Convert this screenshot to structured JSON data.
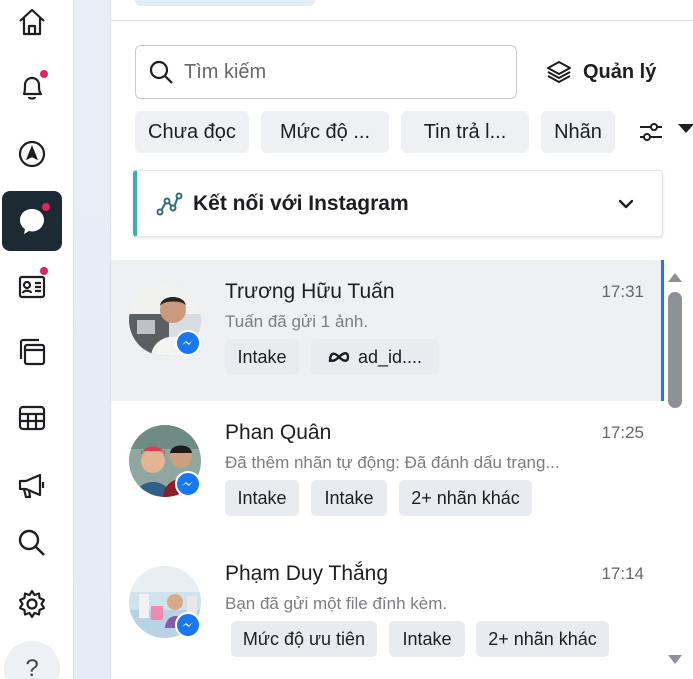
{
  "rail": {
    "items": [
      {
        "icon": "home-icon"
      },
      {
        "icon": "bell-icon",
        "notification": true
      },
      {
        "icon": "compass-icon"
      },
      {
        "icon": "chat-bubble-icon",
        "active": true,
        "notification": true
      },
      {
        "icon": "contact-card-icon",
        "notification": true
      },
      {
        "icon": "pages-icon"
      },
      {
        "icon": "table-icon"
      },
      {
        "icon": "megaphone-icon"
      },
      {
        "icon": "search-icon"
      },
      {
        "icon": "gear-icon"
      }
    ],
    "help_label": "?"
  },
  "search": {
    "placeholder": "Tìm kiếm",
    "value": ""
  },
  "manage": {
    "label": "Quản lý"
  },
  "filters": [
    {
      "label": "Chưa đọc"
    },
    {
      "label": "Mức độ ..."
    },
    {
      "label": "Tin trả l..."
    },
    {
      "label": "Nhãn"
    }
  ],
  "instagram": {
    "label": "Kết nối với Instagram"
  },
  "conversations": [
    {
      "name": "Trương Hữu Tuấn",
      "time": "17:31",
      "preview": "Tuấn đã gửi 1 ảnh.",
      "selected": true,
      "tags": [
        {
          "label": "Intake"
        },
        {
          "label": "ad_id....",
          "icon": "meta-icon"
        }
      ]
    },
    {
      "name": "Phan Quân",
      "time": "17:25",
      "preview": "Đã thêm nhãn tự động: Đã đánh dấu trạng...",
      "selected": false,
      "tags": [
        {
          "label": "Intake"
        },
        {
          "label": "Intake"
        },
        {
          "label": "2+ nhãn khác"
        }
      ]
    },
    {
      "name": "Phạm Duy Thắng",
      "time": "17:14",
      "preview": "Bạn đã gửi một file đính kèm.",
      "selected": false,
      "tags": [
        {
          "label": "Mức độ ưu tiên"
        },
        {
          "label": "Intake"
        },
        {
          "label": "2+ nhãn khác"
        }
      ]
    }
  ],
  "colors": {
    "accent": "#1877f2",
    "instagram_bar": "#36b3a2",
    "notification": "#e0245e",
    "active_rail": "#1c2b33"
  }
}
